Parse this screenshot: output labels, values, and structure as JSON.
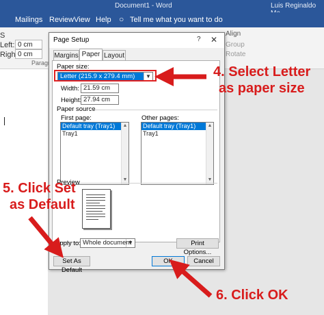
{
  "window": {
    "title": "Document1 - Word",
    "user": "Luis Reginaldo Me"
  },
  "menu": {
    "items": [
      "Mailings",
      "Review",
      "View",
      "Help"
    ],
    "tell_me": "Tell me what you want to do"
  },
  "ribbon": {
    "left_label_partial": "Left:",
    "right_label_partial": "Right:",
    "left_value": "0 cm",
    "right_value": "0 cm",
    "paragraph_partial": "Paragra",
    "partial_s": "S",
    "align": "Align",
    "group": "Group",
    "rotate": "Rotate"
  },
  "dialog": {
    "title": "Page Setup",
    "help": "?",
    "close": "✕",
    "tabs": [
      "Margins",
      "Paper",
      "Layout"
    ],
    "active_tab": "Paper",
    "paper_size_label": "Paper size:",
    "paper_size_value": "Letter (215.9 x 279.4 mm)",
    "width_label": "Width:",
    "width_value": "21.59 cm",
    "height_label": "Height:",
    "height_value": "27.94 cm",
    "paper_source_label": "Paper source",
    "first_page_label": "First page:",
    "other_pages_label": "Other pages:",
    "first_page_items": [
      "Default tray (Tray1)",
      "Tray1"
    ],
    "other_pages_items": [
      "Default tray (Tray1)",
      "Tray1"
    ],
    "preview_label": "Preview",
    "apply_to_label": "Apply to:",
    "apply_to_value": "Whole document",
    "print_options": "Print Options...",
    "set_as_default": "Set As Default",
    "ok": "OK",
    "cancel": "Cancel"
  },
  "annotations": {
    "step4_line1": "4. Select Letter",
    "step4_line2": "as paper size",
    "step5_line1": "5. Click Set",
    "step5_line2": "as Default",
    "step6": "6. Click OK",
    "color": "#d81c1c"
  }
}
